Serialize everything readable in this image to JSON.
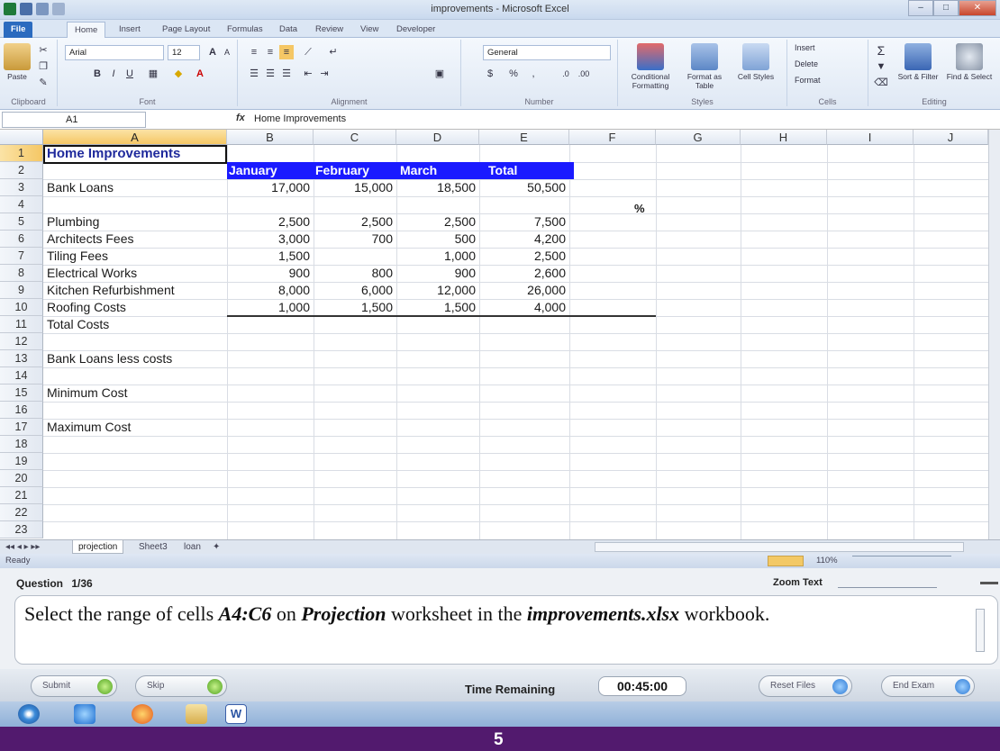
{
  "window": {
    "title": "improvements - Microsoft Excel",
    "min": "–",
    "max": "□",
    "close": "✕"
  },
  "ribbon_tabs": [
    "File",
    "Home",
    "Insert",
    "Page Layout",
    "Formulas",
    "Data",
    "Review",
    "View",
    "Developer"
  ],
  "ribbon": {
    "paste": "Paste",
    "font_name": "Arial",
    "font_size": "12",
    "number_format": "General",
    "conditional_formatting": "Conditional Formatting",
    "format_as_table": "Format as Table",
    "cell_styles": "Cell Styles",
    "insert": "Insert",
    "delete": "Delete",
    "format": "Format",
    "sort_filter": "Sort & Filter",
    "find_select": "Find & Select",
    "groups": {
      "clipboard": "Clipboard",
      "font": "Font",
      "alignment": "Alignment",
      "number": "Number",
      "styles": "Styles",
      "cells": "Cells",
      "editing": "Editing"
    }
  },
  "formula_bar": {
    "name_box": "A1",
    "fx": "fx",
    "content": "Home Improvements"
  },
  "columns": [
    "A",
    "B",
    "C",
    "D",
    "E",
    "F",
    "G",
    "H",
    "I",
    "J"
  ],
  "rows": [
    "1",
    "2",
    "3",
    "4",
    "5",
    "6",
    "7",
    "8",
    "9",
    "10",
    "11",
    "12",
    "13",
    "14",
    "15",
    "16",
    "17",
    "18",
    "19",
    "20",
    "21",
    "22",
    "23"
  ],
  "sheet": {
    "title": "Home Improvements",
    "headers": [
      "January",
      "February",
      "March",
      "Total"
    ],
    "bank_loans": {
      "label": "Bank Loans",
      "values": [
        "17,000",
        "15,000",
        "18,500",
        "50,500"
      ]
    },
    "percent": "%",
    "items": [
      {
        "label": "Plumbing",
        "values": [
          "2,500",
          "2,500",
          "2,500",
          "7,500"
        ]
      },
      {
        "label": "Architects Fees",
        "values": [
          "3,000",
          "700",
          "500",
          "4,200"
        ]
      },
      {
        "label": "Tiling Fees",
        "values": [
          "1,500",
          "",
          "1,000",
          "2,500"
        ]
      },
      {
        "label": "Electrical Works",
        "values": [
          "900",
          "800",
          "900",
          "2,600"
        ]
      },
      {
        "label": "Kitchen Refurbishment",
        "values": [
          "8,000",
          "6,000",
          "12,000",
          "26,000"
        ]
      },
      {
        "label": "Roofing Costs",
        "values": [
          "1,000",
          "1,500",
          "1,500",
          "4,000"
        ]
      }
    ],
    "total_costs": "Total Costs",
    "bank_less_costs": "Bank Loans less costs",
    "minimum_cost": "Minimum Cost",
    "maximum_cost": "Maximum Cost"
  },
  "sheet_tabs": [
    "projection",
    "Sheet3",
    "loan"
  ],
  "status": {
    "ready": "Ready",
    "zoom": "110%"
  },
  "exam": {
    "question_label": "Question",
    "question_number": "1/36",
    "zoom_text": "Zoom Text",
    "q_part1": "Select the range of cells ",
    "q_range": "A4:C6",
    "q_part2": " on ",
    "q_sheet": "Projection",
    "q_part3": " worksheet in the ",
    "q_file": "improvements.xlsx",
    "q_part4": " workbook.",
    "submit": "Submit",
    "skip": "Skip",
    "time_label": "Time Remaining",
    "time_value": "00:45:00",
    "reset": "Reset Files",
    "end": "End Exam"
  },
  "slide_number": "5",
  "colors": {
    "header_fill": "#1a1aff",
    "title_text": "#1f2a9c",
    "slide_bar": "#521a6e"
  }
}
